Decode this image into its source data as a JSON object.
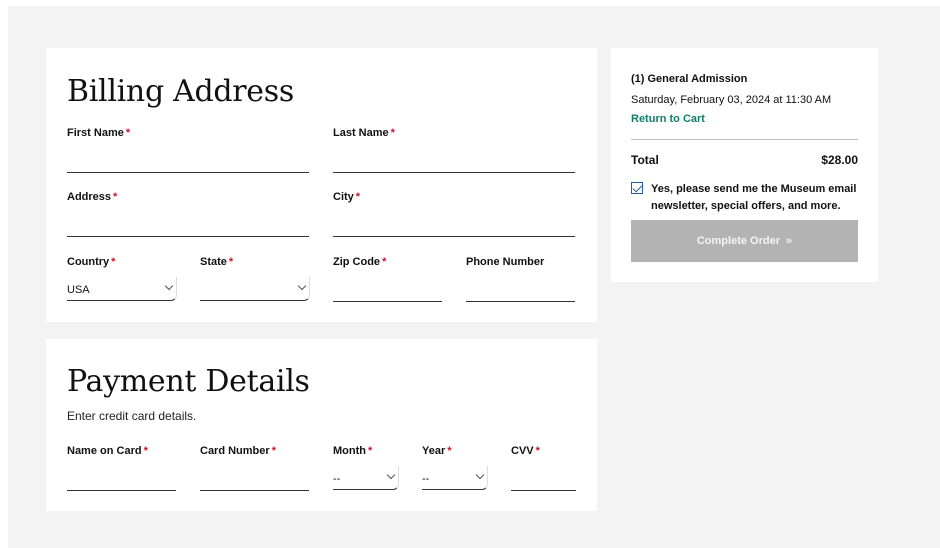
{
  "billing": {
    "title": "Billing Address",
    "fields": {
      "first_name": {
        "label": "First Name",
        "required": "*"
      },
      "last_name": {
        "label": "Last Name",
        "required": "*"
      },
      "address": {
        "label": "Address",
        "required": "*"
      },
      "city": {
        "label": "City",
        "required": "*"
      },
      "country": {
        "label": "Country",
        "required": "*",
        "value": "USA"
      },
      "state": {
        "label": "State",
        "required": "*",
        "value": ""
      },
      "zip": {
        "label": "Zip Code",
        "required": "*"
      },
      "phone": {
        "label": "Phone Number"
      }
    }
  },
  "payment": {
    "title": "Payment Details",
    "subtitle": "Enter credit card details.",
    "fields": {
      "name_on_card": {
        "label": "Name on Card",
        "required": "*"
      },
      "card_number": {
        "label": "Card Number",
        "required": "*"
      },
      "month": {
        "label": "Month",
        "required": "*",
        "value": "--"
      },
      "year": {
        "label": "Year",
        "required": "*",
        "value": "--"
      },
      "cvv": {
        "label": "CVV",
        "required": "*"
      }
    }
  },
  "summary": {
    "item": "(1) General Admission",
    "datetime": "Saturday, February 03, 2024  at 11:30 AM",
    "return_link": "Return to Cart",
    "total_label": "Total",
    "total_value": "$28.00",
    "newsletter_checked": true,
    "newsletter_text": "Yes, please send me the Museum email newsletter, special offers, and more.",
    "complete_label": "Complete Order",
    "complete_arrow": "»"
  },
  "colors": {
    "accent_link": "#0f7e6a",
    "required": "#d0102a",
    "button_disabled": "#b3b3b3",
    "page_bg": "#f3f3f3"
  },
  "icons": {
    "select": "chevron-down-icon",
    "checkbox": "checkmark-icon"
  }
}
